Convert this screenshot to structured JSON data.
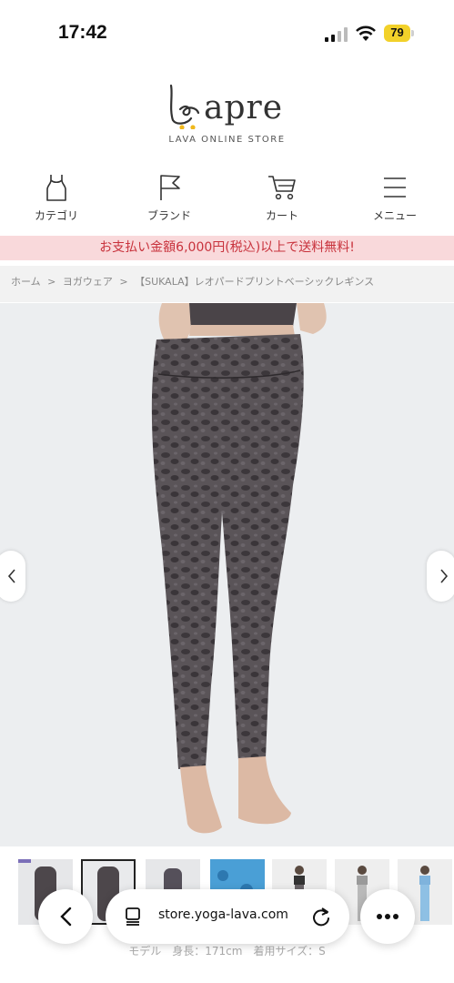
{
  "status": {
    "time": "17:42",
    "battery": "79"
  },
  "logo": {
    "word": "apre",
    "subtitle": "LAVA ONLINE STORE"
  },
  "nav": [
    {
      "label": "カテゴリ",
      "icon": "tank-top-icon"
    },
    {
      "label": "ブランド",
      "icon": "flag-icon"
    },
    {
      "label": "カート",
      "icon": "cart-icon"
    },
    {
      "label": "メニュー",
      "icon": "hamburger-menu-icon"
    }
  ],
  "banner": "お支払い金額6,000円(税込)以上で送料無料!",
  "breadcrumb": [
    "ホーム",
    ">",
    "ヨガウェア",
    ">",
    "【SUKALA】レオパードプリントベーシックレギンス"
  ],
  "browser": {
    "url": "store.yoga-lava.com"
  },
  "caption": "モデル　身長：171cm　着用サイズ：S",
  "colors": {
    "banner_bg": "#f9d9db",
    "banner_text": "#c8323c",
    "battery": "#f2d12a",
    "logo_dot": "#f0b81c"
  }
}
